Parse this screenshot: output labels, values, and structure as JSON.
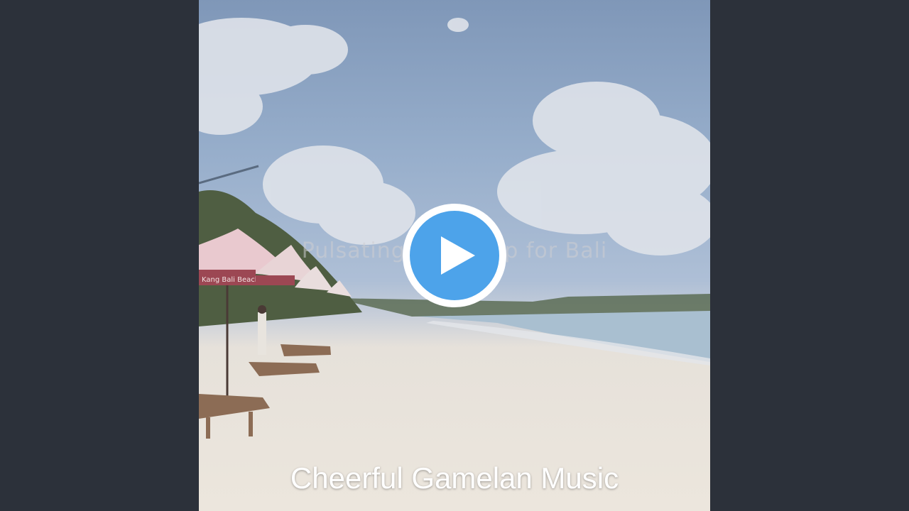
{
  "video": {
    "song_title": "Pulsating Backdrop for Bali",
    "artist": "Cheerful Gamelan Music",
    "umbrella_text": "Kang Bali Beach Clean"
  },
  "controls": {
    "play_icon": "play-icon",
    "accent_color": "#4da3ea"
  },
  "colors": {
    "letterbox": "#2c313a",
    "sky": "#8ea6c4",
    "sand": "#ece6dd",
    "sea": "#a7bdd0"
  }
}
